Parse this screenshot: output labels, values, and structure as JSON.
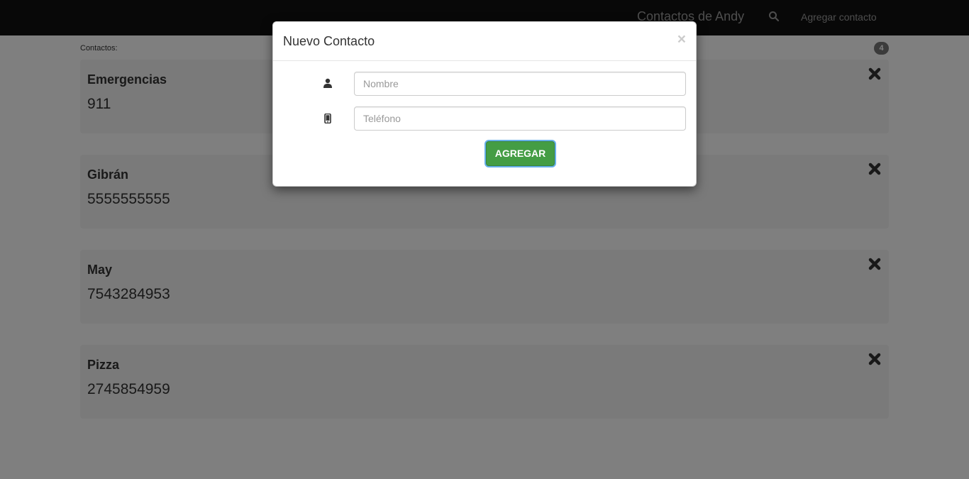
{
  "navbar": {
    "brand": "Contactos de Andy",
    "search_icon": "search-icon",
    "add_contact_label": "Agregar contacto"
  },
  "main": {
    "contacts_label": "Contactos:",
    "count": "4",
    "contacts": [
      {
        "name": "Emergencias",
        "phone": "911"
      },
      {
        "name": "Gibrán",
        "phone": "5555555555"
      },
      {
        "name": "May",
        "phone": "7543284953"
      },
      {
        "name": "Pizza",
        "phone": "2745854959"
      }
    ],
    "delete_icon": "remove-icon"
  },
  "modal": {
    "title": "Nuevo Contacto",
    "close_label": "×",
    "name_field": {
      "icon": "user-icon",
      "placeholder": "Nombre",
      "value": ""
    },
    "phone_field": {
      "icon": "phone-icon",
      "placeholder": "Teléfono",
      "value": ""
    },
    "submit_label": "AGREGAR"
  },
  "colors": {
    "navbar_bg": "#111111",
    "card_bg": "#f5f5f5",
    "badge_bg": "#777777",
    "submit_bg": "#449d44",
    "focus_ring": "#66afe9"
  }
}
